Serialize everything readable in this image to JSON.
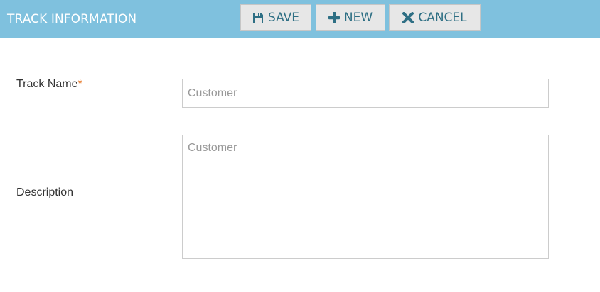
{
  "header": {
    "title": "TRACK INFORMATION",
    "bg_color": "#7fc1de",
    "buttons": [
      {
        "label": "SAVE",
        "icon": "floppy-disk-icon"
      },
      {
        "label": "NEW",
        "icon": "plus-icon"
      },
      {
        "label": "CANCEL",
        "icon": "x-icon"
      }
    ]
  },
  "form": {
    "track_name": {
      "label": "Track Name",
      "required_marker": "*",
      "value": "",
      "placeholder": "Customer"
    },
    "description": {
      "label": "Description",
      "value": "",
      "placeholder": "Customer"
    }
  },
  "colors": {
    "button_text": "#2e6f84",
    "button_bg": "#e7e7e7",
    "required": "#e8843c"
  }
}
